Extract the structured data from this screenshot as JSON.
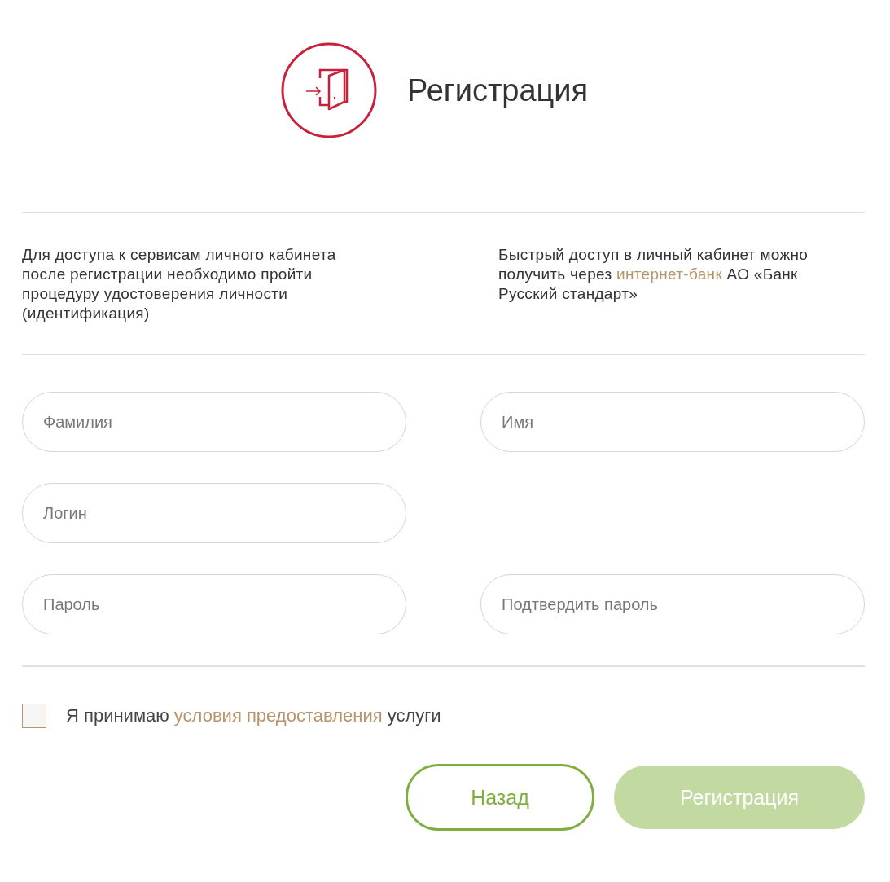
{
  "header": {
    "title": "Регистрация"
  },
  "info": [
    {
      "before": "Для доступа к сервисам личного кабинета после регистрации необходимо пройти процедуру удостоверения личности (идентификация)"
    },
    {
      "before": "Быстрый доступ в личный кабинет можно получить через ",
      "link": "интернет-банк",
      "after": " АО «Банк Русский стандарт»"
    }
  ],
  "field_rows": [
    {
      "left": {
        "placeholder": "Фамилия"
      },
      "right": {
        "placeholder": "Имя"
      }
    },
    {
      "left": {
        "placeholder": "Логин"
      }
    },
    {
      "left": {
        "placeholder": "Пароль"
      },
      "right": {
        "placeholder": "Подтвердить пароль"
      }
    }
  ],
  "agreement": {
    "checked": false,
    "before": "Я принимаю ",
    "link": "условия предоставления",
    "after": " услуги"
  },
  "buttons": [
    {
      "label": "Назад",
      "kind": "secondary",
      "disabled": false
    },
    {
      "label": "Регистрация",
      "kind": "primary",
      "disabled": true
    }
  ]
}
